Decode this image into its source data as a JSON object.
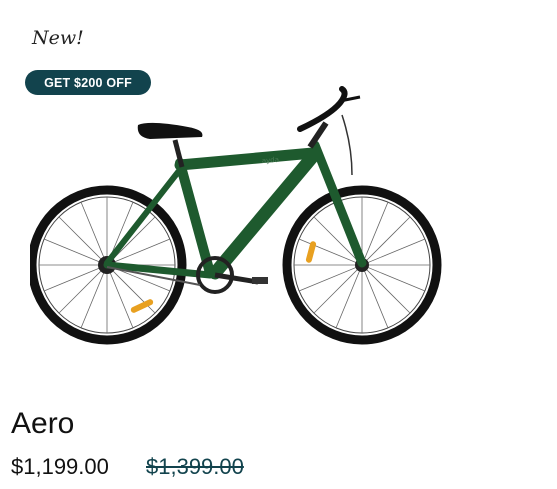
{
  "product": {
    "new_label": "New!",
    "promo_badge": "GET $200 OFF",
    "name": "Aero",
    "price": "$1,199.00",
    "compare_price": "$1,399.00"
  },
  "colors": {
    "badge_bg": "#12434d",
    "frame_green": "#1e5a2e",
    "tire": "#111111"
  },
  "icons": {
    "product_image": "bike-image"
  }
}
